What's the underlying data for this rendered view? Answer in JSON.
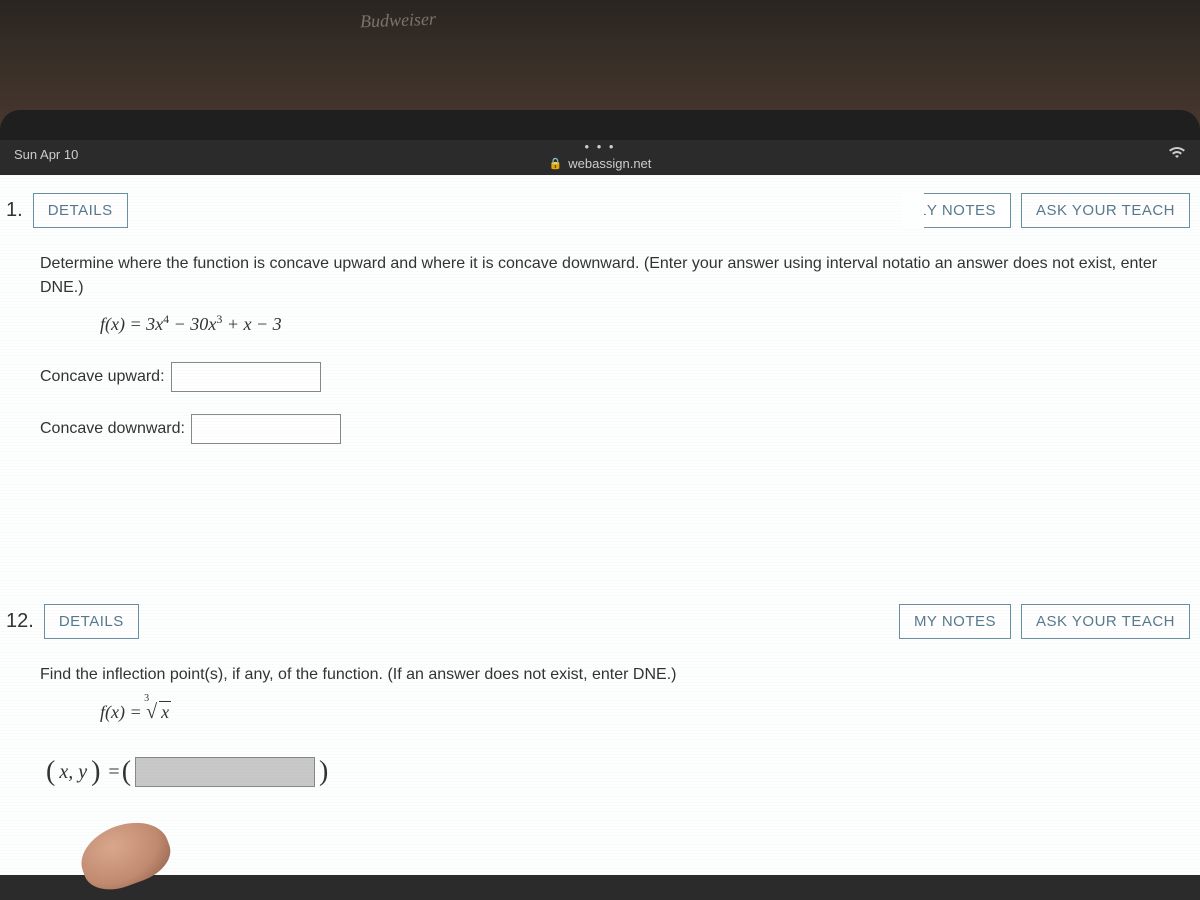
{
  "bg_label": "Budweiser",
  "status": {
    "time": "Sun Apr 10",
    "dots": "• • •",
    "url": "webassign.net"
  },
  "q1": {
    "number": "1.",
    "details": "DETAILS",
    "notes": "MY NOTES",
    "notes_visible": "1Y NOTES",
    "ask": "ASK YOUR TEACH",
    "instruction": "Determine where the function is concave upward and where it is concave downward. (Enter your answer using interval notatio an answer does not exist, enter DNE.)",
    "formula_plain": "f(x) = 3x⁴ − 30x³ + x − 3",
    "label_up": "Concave upward:",
    "label_down": "Concave downward:"
  },
  "q2": {
    "number": "12.",
    "details": "DETAILS",
    "notes": "MY NOTES",
    "ask": "ASK YOUR TEACH",
    "instruction": "Find the inflection point(s), if any, of the function. (If an answer does not exist, enter DNE.)",
    "formula_prefix": "f(x) = ",
    "cuberoot_index": "3",
    "cuberoot_arg": "x",
    "xy_prefix": "(x, y)"
  }
}
